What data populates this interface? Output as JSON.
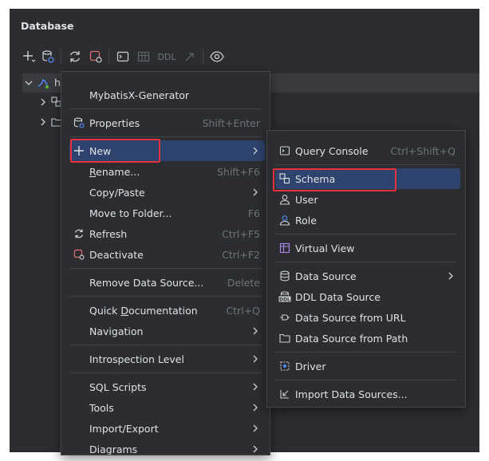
{
  "panel": {
    "title": "Database"
  },
  "toolbar": {
    "ddl_label": "DDL",
    "icons": [
      "add-icon",
      "datasource-settings-icon",
      "refresh-icon",
      "deactivate-icon",
      "console-icon",
      "table-icon",
      "ddl-icon",
      "jump-icon",
      "view-options-icon"
    ]
  },
  "tree": {
    "root_label": "h"
  },
  "colors": {
    "accent_selection": "#2e436e",
    "highlight_box": "#e5323c",
    "panel_bg": "#2b2d30"
  },
  "menu": {
    "items": [
      {
        "id": "mybatisx",
        "label": "MybatisX-Generator"
      },
      {
        "id": "properties",
        "label": "Properties",
        "shortcut": "Shift+Enter"
      },
      {
        "id": "new",
        "label": "New"
      },
      {
        "id": "rename",
        "label_u": "R",
        "label_rest": "ename...",
        "shortcut": "Shift+F6"
      },
      {
        "id": "copy-paste",
        "label": "Copy/Paste"
      },
      {
        "id": "move-folder",
        "label": "Move to Folder...",
        "shortcut": "F6"
      },
      {
        "id": "refresh",
        "label": "Refresh",
        "shortcut": "Ctrl+F5"
      },
      {
        "id": "deactivate",
        "label": "Deactivate",
        "shortcut": "Ctrl+F2"
      },
      {
        "id": "remove-ds",
        "label": "Remove Data Source...",
        "shortcut": "Delete"
      },
      {
        "id": "quick-doc",
        "label_pre": "Quick ",
        "label_u": "D",
        "label_rest": "ocumentation",
        "shortcut": "Ctrl+Q"
      },
      {
        "id": "navigation",
        "label": "Navigation"
      },
      {
        "id": "introspection",
        "label": "Introspection Level"
      },
      {
        "id": "sql-scripts",
        "label": "SQL Scripts"
      },
      {
        "id": "tools",
        "label": "Tools"
      },
      {
        "id": "import-export",
        "label": "Import/Export"
      },
      {
        "id": "diagrams",
        "label": "Diagrams"
      }
    ]
  },
  "submenu": {
    "items": [
      {
        "id": "query-console",
        "label": "Query Console",
        "shortcut": "Ctrl+Shift+Q"
      },
      {
        "id": "schema",
        "label": "Schema"
      },
      {
        "id": "user",
        "label": "User"
      },
      {
        "id": "role",
        "label": "Role"
      },
      {
        "id": "virtual-view",
        "label": "Virtual View"
      },
      {
        "id": "data-source",
        "label": "Data Source"
      },
      {
        "id": "ddl-ds",
        "label": "DDL Data Source"
      },
      {
        "id": "ds-url",
        "label": "Data Source from URL"
      },
      {
        "id": "ds-path",
        "label": "Data Source from Path"
      },
      {
        "id": "driver",
        "label": "Driver"
      },
      {
        "id": "import-ds",
        "label": "Import Data Sources..."
      }
    ]
  }
}
